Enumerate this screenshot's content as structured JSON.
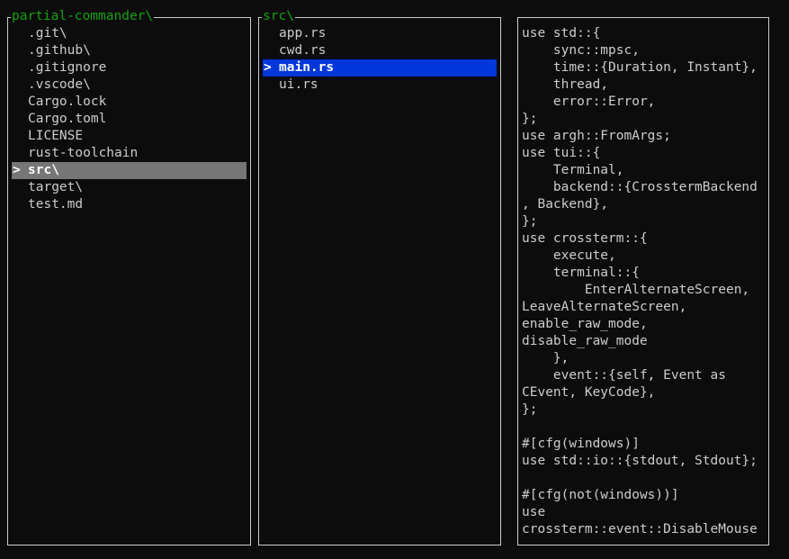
{
  "panes": {
    "left": {
      "title": "partial-commander\\",
      "selected_marker": ">",
      "items": [
        ".git\\",
        ".github\\",
        ".gitignore",
        ".vscode\\",
        "Cargo.lock",
        "Cargo.toml",
        "LICENSE",
        "rust-toolchain",
        "src\\",
        "target\\",
        "test.md"
      ],
      "selected_index": 8
    },
    "middle": {
      "title": "src\\",
      "selected_marker": ">",
      "items": [
        "app.rs",
        "cwd.rs",
        "main.rs",
        "ui.rs"
      ],
      "selected_index": 2
    },
    "right": {
      "lines": [
        "use std::{",
        "    sync::mpsc,",
        "    time::{Duration, Instant},",
        "    thread,",
        "    error::Error,",
        "};",
        "use argh::FromArgs;",
        "use tui::{",
        "    Terminal,",
        "    backend::{CrosstermBackend",
        ", Backend},",
        "};",
        "use crossterm::{",
        "    execute,",
        "    terminal::{",
        "        EnterAlternateScreen,",
        "LeaveAlternateScreen,",
        "enable_raw_mode,",
        "disable_raw_mode",
        "    },",
        "    event::{self, Event as",
        "CEvent, KeyCode},",
        "};",
        "",
        "#[cfg(windows)]",
        "use std::io::{stdout, Stdout};",
        "",
        "#[cfg(not(windows))]",
        "use",
        "crossterm::event::DisableMouse"
      ]
    }
  },
  "colors": {
    "background": "#0c0c0c",
    "foreground": "#cccccc",
    "title": "#13a10e",
    "dir_selection": "#767676",
    "file_selection": "#0037da"
  }
}
